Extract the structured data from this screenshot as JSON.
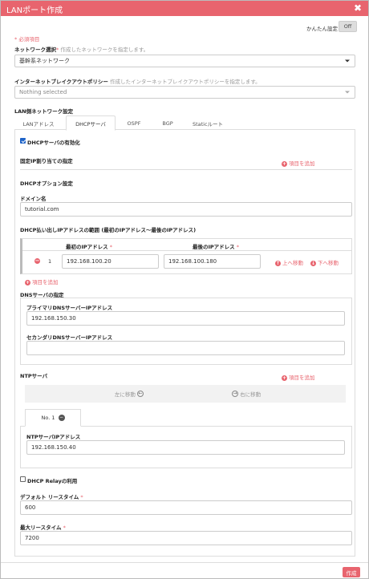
{
  "window": {
    "title": "LANポート作成"
  },
  "easy_setting": {
    "label": "かんたん設定",
    "toggle": "Off"
  },
  "required_note": "* 必須項目",
  "network_select": {
    "label": "ネットワーク選択",
    "required_mark": "*",
    "hint": "作成したネットワークを指定します。",
    "value": "基幹系ネットワーク"
  },
  "breakout_policy": {
    "label": "インターネットブレイクアウトポリシー",
    "hint": "作成したインターネットブレイクアウトポリシーを指定します。",
    "placeholder": "Nothing selected"
  },
  "lan_settings_label": "LAN側ネットワーク設定",
  "tabs": [
    {
      "label": "LANアドレス"
    },
    {
      "label": "DHCPサーバ"
    },
    {
      "label": "OSPF"
    },
    {
      "label": "BGP"
    },
    {
      "label": "Staticルート"
    }
  ],
  "dhcp": {
    "enable_label": "DHCPサーバの有効化",
    "fixed_ip_label": "固定IP割り当ての指定",
    "add_item": "項目を追加",
    "option_label": "DHCPオプション設定",
    "domain_label": "ドメイン名",
    "domain_value": "tutorial.com",
    "range_label": "DHCP払い出しIPアドレスの範囲 (最初のIPアドレス～最後のIPアドレス)",
    "range_first_header": "最初のIPアドレス",
    "range_last_header": "最後のIPアドレス",
    "range_required": "*",
    "range_row_index": "1",
    "range_first": "192.168.100.20",
    "range_last": "192.168.100.180",
    "move_up": "上へ移動",
    "move_down": "下へ移動",
    "dns_label": "DNSサーバの指定",
    "dns_primary_label": "プライマリDNSサーバーIPアドレス",
    "dns_primary_value": "192.168.150.30",
    "dns_secondary_label": "セカンダリDNSサーバーIPアドレス",
    "dns_secondary_value": "",
    "ntp_label": "NTPサーバ",
    "scroll_left": "左に移動",
    "scroll_right": "右に移動",
    "ntp_tab": "No. 1",
    "ntp_ip_label": "NTPサーバIPアドレス",
    "ntp_ip_value": "192.168.150.40",
    "relay_label": "DHCP Relayの利用",
    "default_lease_label": "デフォルト リースタイム",
    "default_lease_value": "600",
    "max_lease_label": "最大リースタイム",
    "max_lease_value": "7200"
  },
  "footer": {
    "create": "作成"
  },
  "colors": {
    "accent": "#e8646e",
    "checkbox": "#1e63c8"
  }
}
